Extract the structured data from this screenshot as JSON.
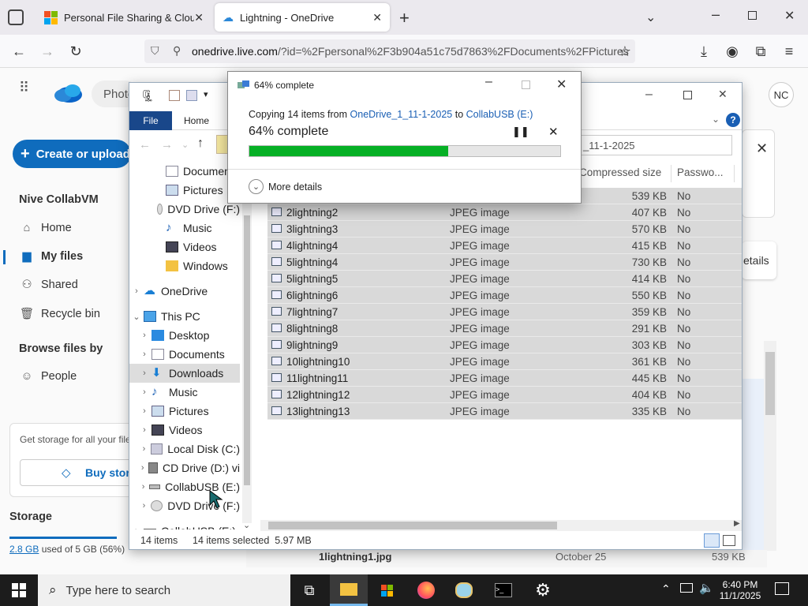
{
  "browser": {
    "tabs": [
      {
        "title": "Personal File Sharing & Cloud S"
      },
      {
        "title": "Lightning - OneDrive"
      }
    ],
    "url_host": "onedrive.live.com",
    "url_rest": "/?id=%2Fpersonal%2F3b904a51c75d7863%2FDocuments%2FPictures"
  },
  "onedrive": {
    "search_chip": "Photo",
    "create_label": "Create or upload",
    "account_name": "Nive CollabVM",
    "avatar_initials": "NC",
    "nav": [
      "Home",
      "My files",
      "Shared",
      "Recycle bin"
    ],
    "browse_heading": "Browse files by",
    "people": "People",
    "storage_promo": "Get storage for all your file",
    "buy_storage": "Buy stora",
    "storage_heading": "Storage",
    "storage_used_link": "2.8 GB",
    "storage_used_rest": "used of 5 GB (56%)",
    "details_btn": "etails",
    "bottom_row_name": "1lightning1.jpg",
    "bottom_row_date": "October 25",
    "bottom_row_size": "539 KB"
  },
  "explorer": {
    "ribbon_file": "File",
    "ribbon_home": "Home",
    "path_tail": "_11-1-2025",
    "columns": {
      "size": "Compressed size",
      "password": "Passwo..."
    },
    "tree": [
      {
        "label": "Documents",
        "icon": "documents-icon",
        "arrow": ""
      },
      {
        "label": "Pictures",
        "icon": "pictures-icon",
        "arrow": ""
      },
      {
        "label": "DVD Drive (F:)",
        "icon": "dvd-icon",
        "arrow": ""
      },
      {
        "label": "Music",
        "icon": "music-icon",
        "arrow": ""
      },
      {
        "label": "Videos",
        "icon": "videos-icon",
        "arrow": ""
      },
      {
        "label": "Windows",
        "icon": "folder-icon",
        "arrow": ""
      },
      {
        "label": "OneDrive",
        "icon": "cloud-icon",
        "arrow": ">"
      },
      {
        "label": "This PC",
        "icon": "pc-icon",
        "arrow": "v"
      },
      {
        "label": "Desktop",
        "icon": "desktop-icon",
        "arrow": ">"
      },
      {
        "label": "Documents",
        "icon": "documents-icon",
        "arrow": ">"
      },
      {
        "label": "Downloads",
        "icon": "downloads-icon",
        "arrow": ">"
      },
      {
        "label": "Music",
        "icon": "music-icon",
        "arrow": ">"
      },
      {
        "label": "Pictures",
        "icon": "pictures-icon",
        "arrow": ">"
      },
      {
        "label": "Videos",
        "icon": "videos-icon",
        "arrow": ">"
      },
      {
        "label": "Local Disk (C:)",
        "icon": "disk-icon",
        "arrow": ">"
      },
      {
        "label": "CD Drive (D:) vi",
        "icon": "cd-icon",
        "arrow": ">"
      },
      {
        "label": "CollabUSB (E:)",
        "icon": "usb-icon",
        "arrow": ">"
      },
      {
        "label": "DVD Drive (F:)",
        "icon": "dvd-icon",
        "arrow": ">"
      },
      {
        "label": "CollabUSB (E:)",
        "icon": "usb-icon",
        "arrow": ">"
      }
    ],
    "files": [
      {
        "name": "",
        "type": "",
        "size": "539 KB",
        "pw": "No"
      },
      {
        "name": "2lightning2",
        "type": "JPEG image",
        "size": "407 KB",
        "pw": "No"
      },
      {
        "name": "3lightning3",
        "type": "JPEG image",
        "size": "570 KB",
        "pw": "No"
      },
      {
        "name": "4lightning4",
        "type": "JPEG image",
        "size": "415 KB",
        "pw": "No"
      },
      {
        "name": "5lightning4",
        "type": "JPEG image",
        "size": "730 KB",
        "pw": "No"
      },
      {
        "name": "5lightning5",
        "type": "JPEG image",
        "size": "414 KB",
        "pw": "No"
      },
      {
        "name": "6lightning6",
        "type": "JPEG image",
        "size": "550 KB",
        "pw": "No"
      },
      {
        "name": "7lightning7",
        "type": "JPEG image",
        "size": "359 KB",
        "pw": "No"
      },
      {
        "name": "8lightning8",
        "type": "JPEG image",
        "size": "291 KB",
        "pw": "No"
      },
      {
        "name": "9lightning9",
        "type": "JPEG image",
        "size": "303 KB",
        "pw": "No"
      },
      {
        "name": "10lightning10",
        "type": "JPEG image",
        "size": "361 KB",
        "pw": "No"
      },
      {
        "name": "11lightning11",
        "type": "JPEG image",
        "size": "445 KB",
        "pw": "No"
      },
      {
        "name": "12lightning12",
        "type": "JPEG image",
        "size": "404 KB",
        "pw": "No"
      },
      {
        "name": "13lightning13",
        "type": "JPEG image",
        "size": "335 KB",
        "pw": "No"
      }
    ],
    "status_items": "14 items",
    "status_selected": "14 items selected  5.97 MB"
  },
  "dialog": {
    "title": "64% complete",
    "copy_prefix": "Copying 14 items from ",
    "source": "OneDrive_1_11-1-2025",
    "to": " to ",
    "dest": "CollabUSB (E:)",
    "percent_text": "64% complete",
    "progress": 0.64,
    "more_details": "More details"
  },
  "taskbar": {
    "search_placeholder": "Type here to search",
    "time": "6:40 PM",
    "date": "11/1/2025"
  },
  "colors": {
    "progress": "#06b025",
    "accent": "#0f6cbd",
    "link": "#1a5fb4"
  }
}
